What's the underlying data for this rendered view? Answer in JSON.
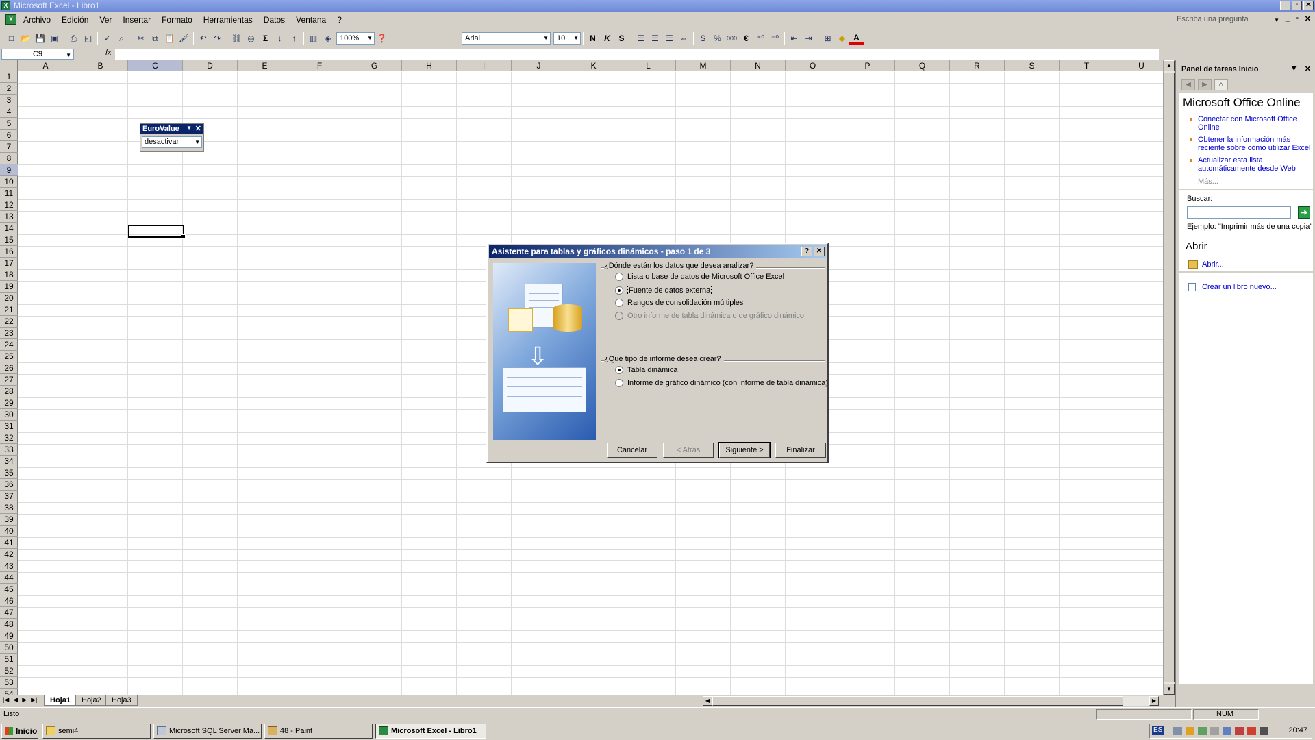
{
  "window": {
    "title": "Microsoft Excel - Libro1"
  },
  "menu": [
    "Archivo",
    "Edición",
    "Ver",
    "Insertar",
    "Formato",
    "Herramientas",
    "Datos",
    "Ventana",
    "?"
  ],
  "ask_placeholder": "Escriba una pregunta",
  "toolbar": {
    "zoom": "100%",
    "font": "Arial",
    "size": "10",
    "bold": "N",
    "italic": "K",
    "underline": "S",
    "sum": "Σ",
    "percent": "%",
    "thousands": "000",
    "euro": "€",
    "font_color": "A"
  },
  "formula": {
    "namebox": "C9",
    "fx": "fx",
    "value": ""
  },
  "columns": [
    "A",
    "B",
    "C",
    "D",
    "E",
    "F",
    "G",
    "H",
    "I",
    "J",
    "K",
    "L",
    "M",
    "N",
    "O",
    "P",
    "Q",
    "R",
    "S",
    "T",
    "U"
  ],
  "selected_column": "C",
  "selected_row": 9,
  "rows_visible": 54,
  "eurovalue": {
    "title": "EuroValue",
    "value": "desactivar"
  },
  "sheets": [
    "Hoja1",
    "Hoja2",
    "Hoja3"
  ],
  "active_sheet": "Hoja1",
  "status": {
    "text": "Listo",
    "num": "NUM"
  },
  "taskpane": {
    "header": "Panel de tareas Inicio",
    "office_title": "Microsoft Office Online",
    "links": [
      "Conectar con Microsoft Office Online",
      "Obtener la información más reciente sobre cómo utilizar Excel",
      "Actualizar esta lista automáticamente desde Web"
    ],
    "more": "Más...",
    "search_label": "Buscar:",
    "example": "Ejemplo: \"Imprimir más de una copia\"",
    "open_title": "Abrir",
    "open_link": "Abrir...",
    "new_link": "Crear un libro nuevo..."
  },
  "dialog": {
    "title": "Asistente para tablas y gráficos dinámicos - paso 1 de 3",
    "q1": "¿Dónde están los datos que desea analizar?",
    "options1": [
      {
        "label": "Lista o base de datos de Microsoft Office Excel",
        "checked": false,
        "disabled": false
      },
      {
        "label": "Fuente de datos externa",
        "checked": true,
        "disabled": false
      },
      {
        "label": "Rangos de consolidación múltiples",
        "checked": false,
        "disabled": false
      },
      {
        "label": "Otro informe de tabla dinámica o de gráfico dinámico",
        "checked": false,
        "disabled": true
      }
    ],
    "q2": "¿Qué tipo de informe desea crear?",
    "options2": [
      {
        "label": "Tabla dinámica",
        "checked": true
      },
      {
        "label": "Informe de gráfico dinámico (con informe de tabla dinámica)",
        "checked": false
      }
    ],
    "buttons": {
      "cancel": "Cancelar",
      "back": "< Atrás",
      "next": "Siguiente >",
      "finish": "Finalizar"
    }
  },
  "taskbar": {
    "start": "Inicio",
    "items": [
      {
        "label": "semi4",
        "active": false
      },
      {
        "label": "Microsoft SQL Server Ma...",
        "active": false
      },
      {
        "label": "48 - Paint",
        "active": false
      },
      {
        "label": "Microsoft Excel - Libro1",
        "active": true
      }
    ],
    "lang": "ES",
    "clock": "20:47"
  }
}
